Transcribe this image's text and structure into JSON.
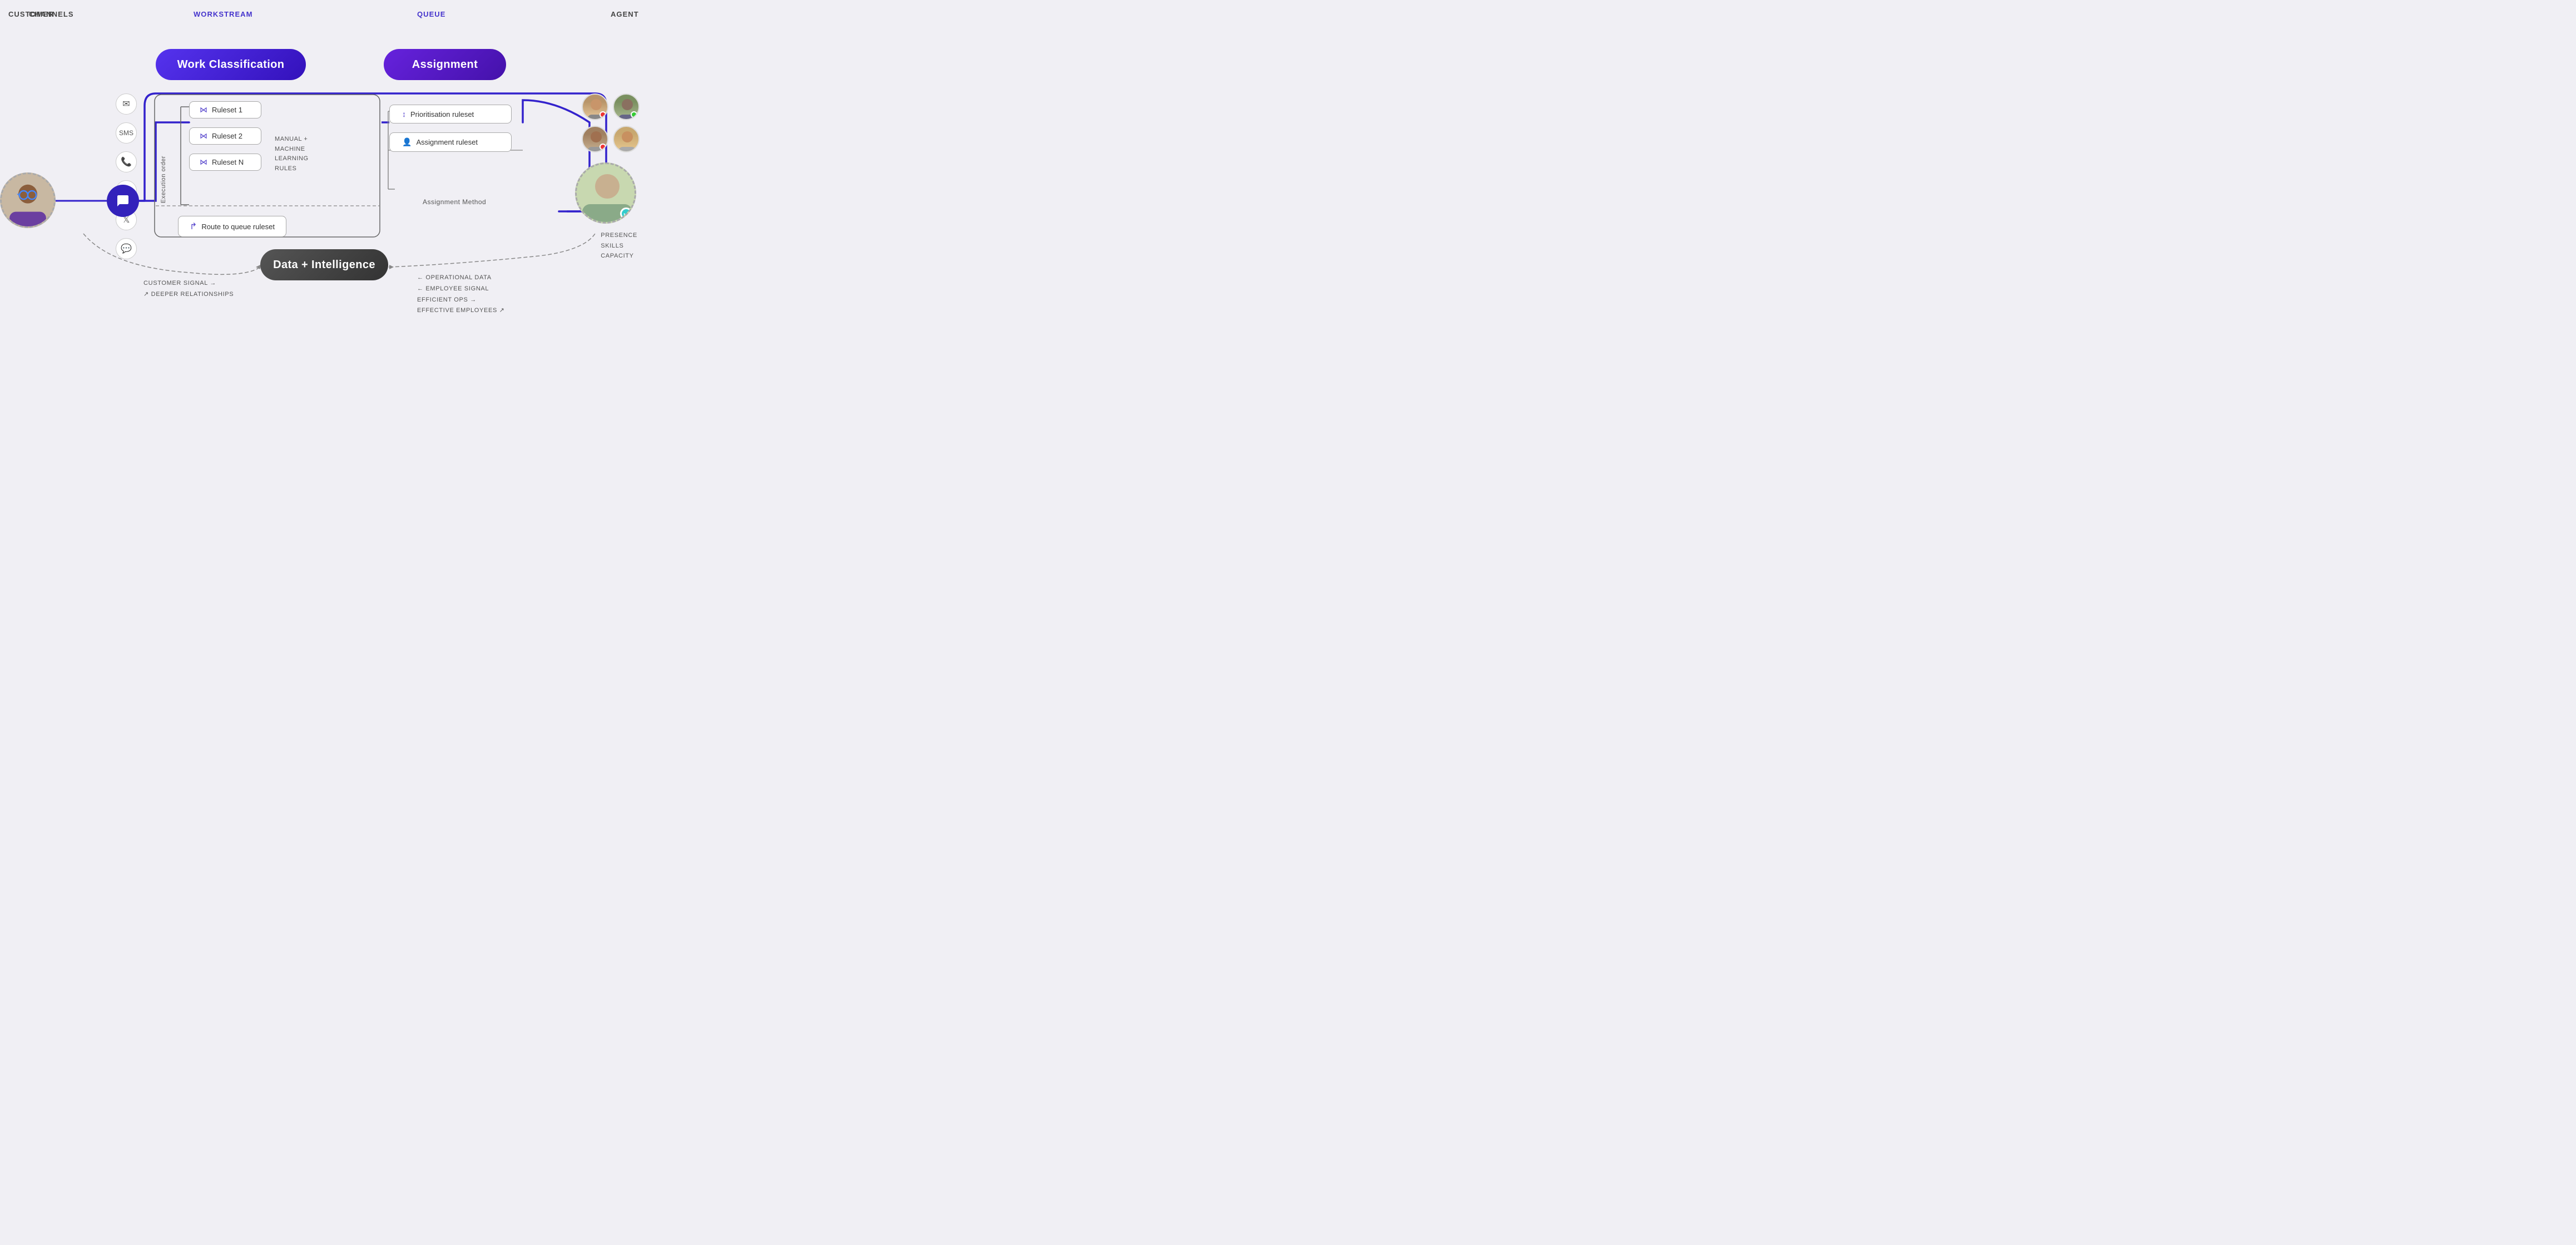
{
  "headers": {
    "customer": "CUSTOMER",
    "channels": "CHANNELS",
    "workstream": "WORKSTREAM",
    "queue": "QUEUE",
    "agent": "AGENT"
  },
  "boxes": {
    "work_classification": "Work Classification",
    "assignment": "Assignment",
    "data_intelligence": "Data + Intelligence"
  },
  "rulesets": [
    {
      "label": "Ruleset 1"
    },
    {
      "label": "Ruleset 2"
    },
    {
      "label": "Ruleset N"
    }
  ],
  "ml_rules": {
    "line1": "MANUAL +",
    "line2": "MACHINE",
    "line3": "LEARNING",
    "line4": "RULES"
  },
  "route_box": {
    "label": "Route to queue ruleset"
  },
  "execution_label": "Execution order",
  "queue_items": [
    {
      "label": "Prioritisation ruleset"
    },
    {
      "label": "Assignment ruleset"
    }
  ],
  "assignment_method": "Assignment Method",
  "agent_labels": {
    "presence": "PRESENCE",
    "skills": "SKILLS",
    "capacity": "CAPACITY"
  },
  "di_left": {
    "line1": "CUSTOMER SIGNAL →",
    "line2": "↗ DEEPER RELATIONSHIPS"
  },
  "di_right": {
    "line1": "← OPERATIONAL DATA",
    "line2": "← EMPLOYEE SIGNAL",
    "line3": "EFFICIENT OPS →",
    "line4": "EFFECTIVE EMPLOYEES ↗"
  }
}
